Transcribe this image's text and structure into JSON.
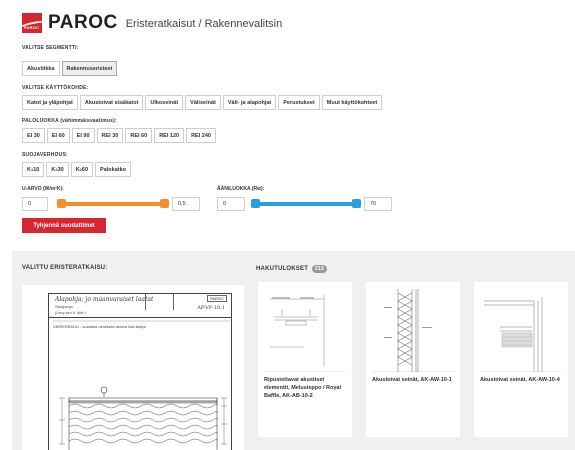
{
  "header": {
    "logo_word": "PAROC",
    "brand": "PAROC",
    "title": "Eristeratkaisut / Rakennevalitsin"
  },
  "segment": {
    "label": "VALITSE SEGMENTTI:",
    "options": [
      "Akustiikka",
      "Rakennuseristeet"
    ],
    "selected": "Rakennuseristeet"
  },
  "usage": {
    "label": "VALITSE KÄYTTÖKOHDE:",
    "options": [
      "Katot ja yläpohjat",
      "Akustoivat sisäkatot",
      "Ulkoseinät",
      "Väliseinät",
      "Väli- ja alapohjat",
      "Perustukset",
      "Muut käyttökohteet"
    ]
  },
  "fire_class": {
    "label": "PALOLUOKKA (vähimmäisvaatimus):",
    "options": [
      "EI 30",
      "EI 60",
      "EI 90",
      "REI 30",
      "REI 60",
      "REI 120",
      "REI 240"
    ]
  },
  "protection": {
    "label": "SUOJAVERHOUS:",
    "options": [
      {
        "main": "K",
        "sub": "1",
        "rest": "10"
      },
      {
        "main": "K",
        "sub": "2",
        "rest": "30"
      },
      {
        "main": "K",
        "sub": "2",
        "rest": "60"
      },
      {
        "main": "Palokatko",
        "sub": "",
        "rest": ""
      }
    ]
  },
  "u_value": {
    "label": "U-ARVO (W/m²K):",
    "min": "0",
    "max": "0,5",
    "range_min": 0,
    "range_max": 0.5,
    "color": "#f0902b"
  },
  "sound_class": {
    "label": "ÄÄNILUOKKA (Rw):",
    "min": "0",
    "max": "70",
    "range_min": 0,
    "range_max": 70,
    "color": "#2a9fe0"
  },
  "clear_button": "Tyhjennä suodattimet",
  "selected_section": {
    "heading": "VALITTU ERISTERATKAISU:",
    "drawing_title": "Alapohja; jo maanvaraiset laatat",
    "drawing_sub1": "Sisäpohja",
    "drawing_sub2": "(Levy pro h. klkr.)",
    "drawing_code": "AP-VF-10.1",
    "drawing_logo": "PAROC",
    "drawing_note": "VÄRIERÄSUU  - suositus nimetaan avuksi lisä-lisäys"
  },
  "results": {
    "heading": "HAKUTULOKSET",
    "count": "213",
    "items": [
      {
        "title": "Ripustettavat akustiset elementit, Melusieppo / Royal Baffle, AK-AB-10-2"
      },
      {
        "title": "Akustoivat seinät, AK-AW-10-1"
      },
      {
        "title": "Akustoivat seinät, AK-AW-10-4"
      }
    ]
  },
  "colors": {
    "brand_red": "#d8262e",
    "orange": "#f0902b",
    "blue": "#2a9fe0"
  }
}
